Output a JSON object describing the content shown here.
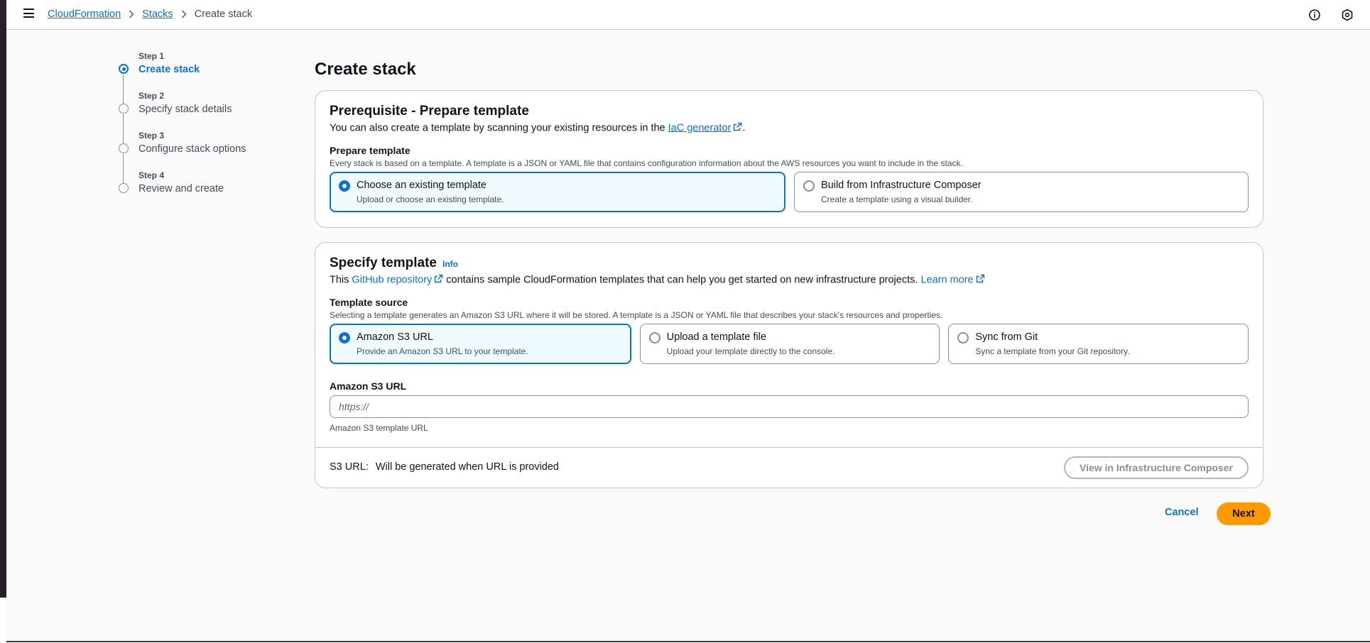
{
  "breadcrumb": {
    "items": [
      "CloudFormation",
      "Stacks"
    ],
    "current": "Create stack"
  },
  "steps": [
    {
      "number": "Step 1",
      "title": "Create stack",
      "active": true
    },
    {
      "number": "Step 2",
      "title": "Specify stack details",
      "active": false
    },
    {
      "number": "Step 3",
      "title": "Configure stack options",
      "active": false
    },
    {
      "number": "Step 4",
      "title": "Review and create",
      "active": false
    }
  ],
  "page_title": "Create stack",
  "prerequisite": {
    "heading": "Prerequisite - Prepare template",
    "desc_prefix": "You can also create a template by scanning your existing resources in the ",
    "desc_link": "IaC generator",
    "desc_suffix": ".",
    "field_label": "Prepare template",
    "field_desc": "Every stack is based on a template. A template is a JSON or YAML file that contains configuration information about the AWS resources you want to include in the stack.",
    "options": [
      {
        "title": "Choose an existing template",
        "subtitle": "Upload or choose an existing template.",
        "selected": true
      },
      {
        "title": "Build from Infrastructure Composer",
        "subtitle": "Create a template using a visual builder.",
        "selected": false
      }
    ]
  },
  "specify": {
    "heading": "Specify template",
    "info": "Info",
    "desc_prefix": "This ",
    "desc_link": "GitHub repository",
    "desc_middle": " contains sample CloudFormation templates that can help you get started on new infrastructure projects. ",
    "learn_more": "Learn more",
    "source_label": "Template source",
    "source_desc": "Selecting a template generates an Amazon S3 URL where it will be stored. A template is a JSON or YAML file that describes your stack's resources and properties.",
    "options": [
      {
        "title": "Amazon S3 URL",
        "subtitle": "Provide an Amazon S3 URL to your template.",
        "selected": true
      },
      {
        "title": "Upload a template file",
        "subtitle": "Upload your template directly to the console.",
        "selected": false
      },
      {
        "title": "Sync from Git",
        "subtitle": "Sync a template from your Git repository.",
        "selected": false
      }
    ],
    "s3_label": "Amazon S3 URL",
    "s3_placeholder": "https://",
    "s3_hint": "Amazon S3 template URL",
    "footer_key": "S3 URL:",
    "footer_value": "Will be generated when URL is provided",
    "composer_button": "View in Infrastructure Composer"
  },
  "actions": {
    "cancel": "Cancel",
    "next": "Next"
  },
  "colors": {
    "link": "#0972d3",
    "primary_button": "#ff9900",
    "selected_tile_bg": "#f0fbff"
  }
}
